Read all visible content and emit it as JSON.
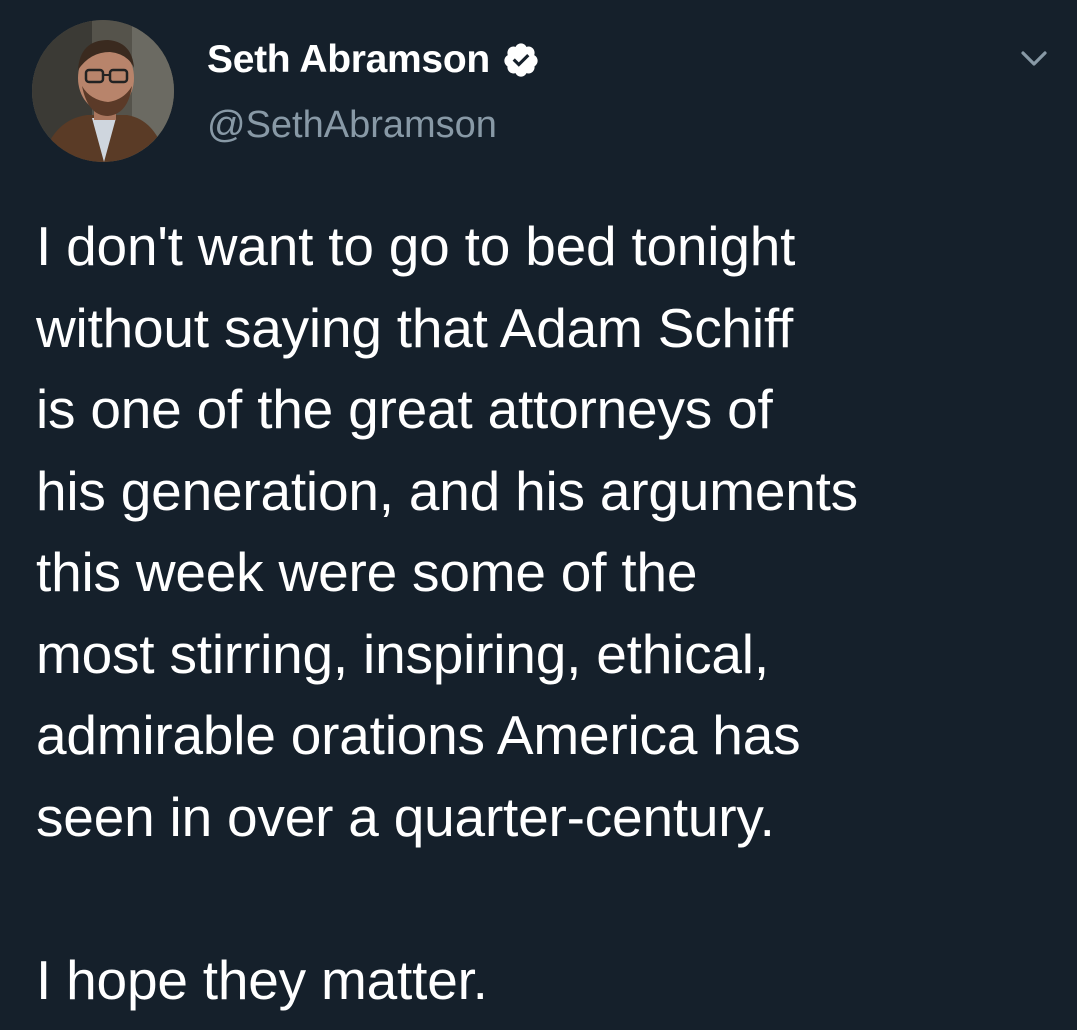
{
  "tweet": {
    "author": {
      "display_name": "Seth Abramson",
      "handle": "@SethAbramson",
      "verified": true
    },
    "text": "I don't want to go to bed tonight\nwithout saying that Adam Schiff\nis one of the great attorneys of\nhis generation, and his arguments\nthis week were some of the\nmost stirring, inspiring, ethical,\nadmirable orations America has\nseen in over a quarter-century.\n\nI hope they matter."
  },
  "icons": {
    "verified": "verified-badge-icon",
    "caret": "chevron-down-icon"
  },
  "colors": {
    "background": "#15202b",
    "text": "#ffffff",
    "secondary_text": "#8899a6"
  }
}
